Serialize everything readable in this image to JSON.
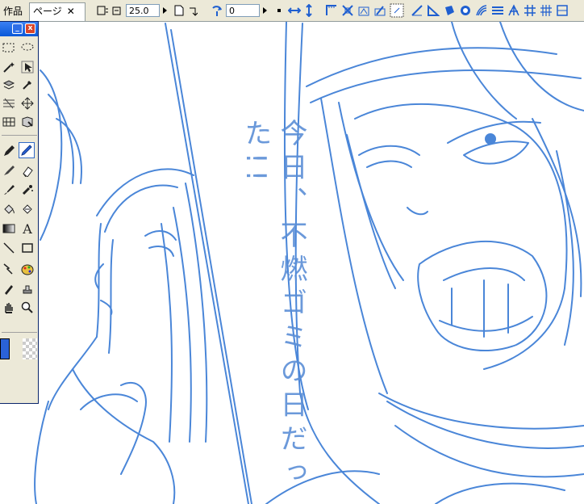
{
  "tabs": {
    "prev_label": "作品",
    "active_label": "ページ",
    "close_glyph": "✕"
  },
  "toolbar": {
    "zoom_value": "25.0",
    "rotate_value": "0"
  },
  "canvas": {
    "handwritten_text": "今日、不燃ゴミの日だった!!"
  },
  "palette": {
    "text_tool_glyph": "A",
    "minimize_glyph": "_",
    "close_glyph": "x"
  },
  "colors": {
    "drawing_color": "#2a62d8",
    "toolbar_bg": "#ece9d8",
    "title_blue": "#0a58d8"
  }
}
